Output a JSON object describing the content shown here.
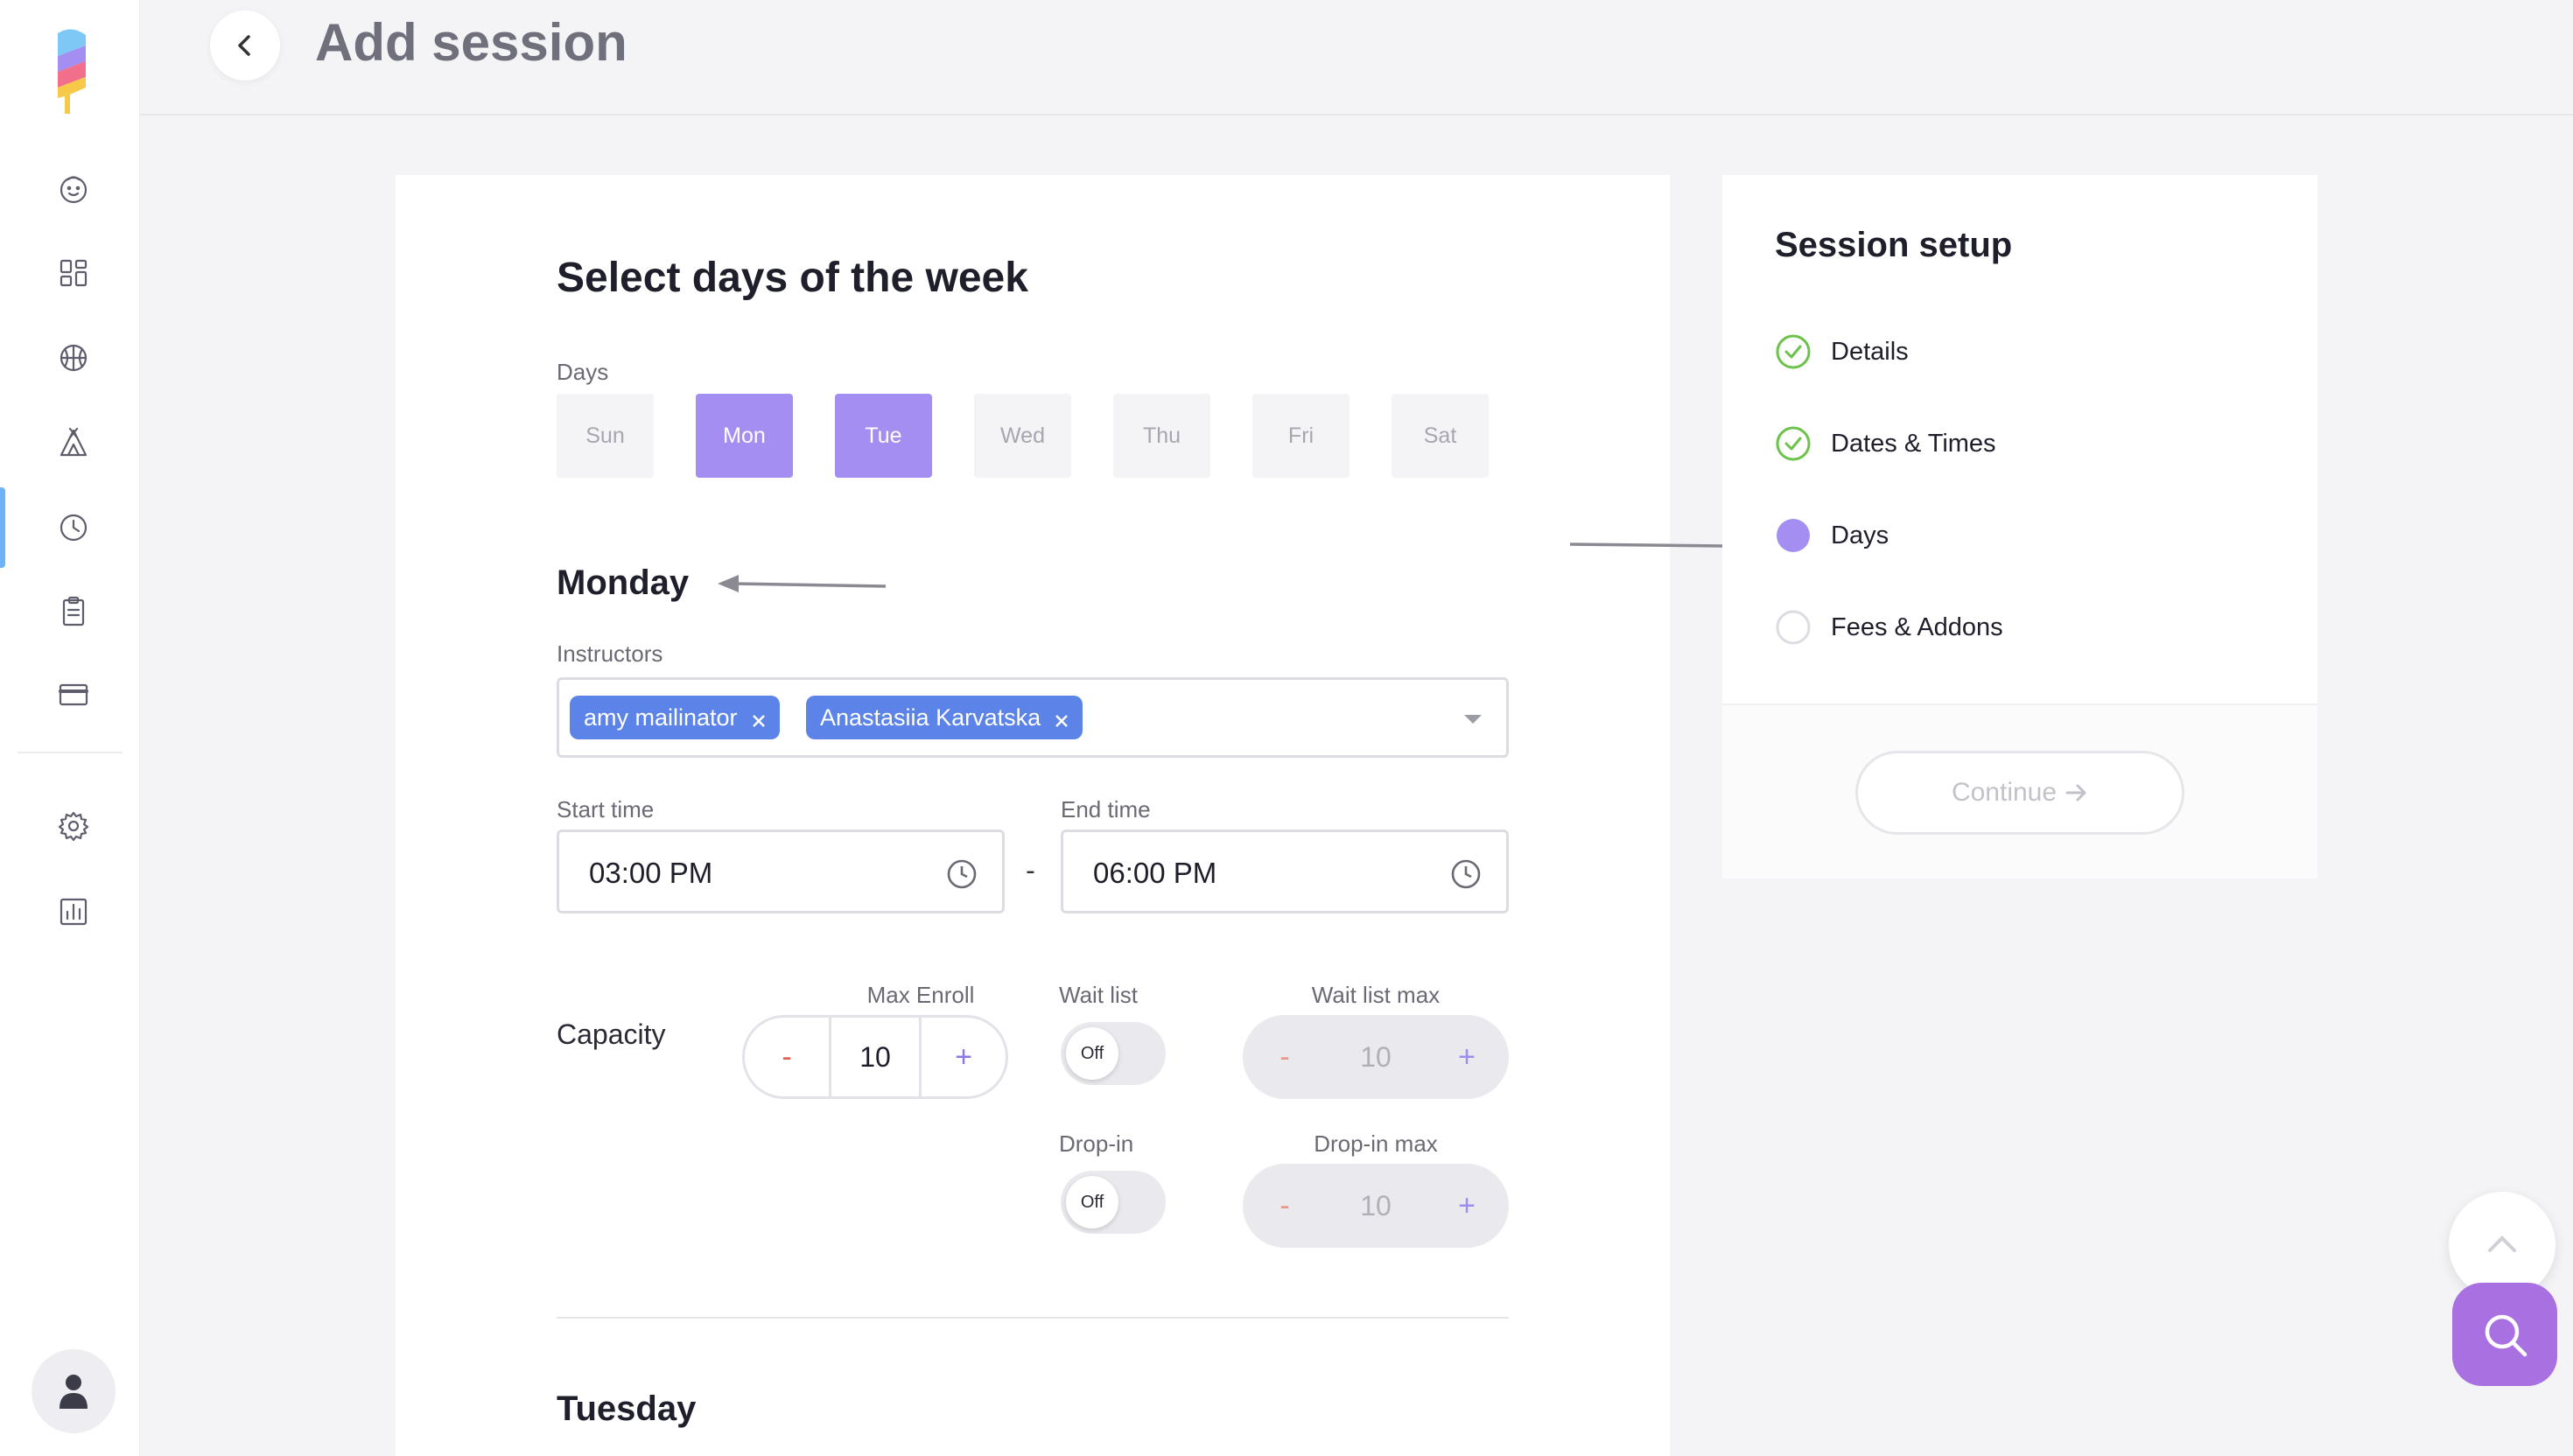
{
  "header": {
    "title": "Add session"
  },
  "main": {
    "section_title": "Select days of the week",
    "days_label": "Days",
    "days": [
      {
        "label": "Sun",
        "selected": false
      },
      {
        "label": "Mon",
        "selected": true
      },
      {
        "label": "Tue",
        "selected": true
      },
      {
        "label": "Wed",
        "selected": false
      },
      {
        "label": "Thu",
        "selected": false
      },
      {
        "label": "Fri",
        "selected": false
      },
      {
        "label": "Sat",
        "selected": false
      }
    ],
    "monday": {
      "heading": "Monday",
      "instructors_label": "Instructors",
      "instructors": [
        "amy mailinator",
        "Anastasiia Karvatska"
      ],
      "start_label": "Start time",
      "start_value": "03:00 PM",
      "end_label": "End time",
      "end_value": "06:00 PM",
      "dash": "-",
      "capacity_label": "Capacity",
      "max_enroll_label": "Max Enroll",
      "max_enroll": "10",
      "wait_list_label": "Wait list",
      "wait_list_state": "Off",
      "wait_list_max_label": "Wait list max",
      "wait_list_max": "10",
      "drop_in_label": "Drop-in",
      "drop_in_state": "Off",
      "drop_in_max_label": "Drop-in max",
      "drop_in_max": "10",
      "minus": "-",
      "plus": "+"
    },
    "tuesday": {
      "heading": "Tuesday"
    }
  },
  "setup": {
    "title": "Session setup",
    "steps": [
      {
        "label": "Details",
        "state": "done"
      },
      {
        "label": "Dates & Times",
        "state": "done"
      },
      {
        "label": "Days",
        "state": "current"
      },
      {
        "label": "Fees & Addons",
        "state": "pending"
      }
    ],
    "continue_label": "Continue"
  },
  "colors": {
    "accent_purple": "#a48ef2",
    "chip_blue": "#5b83e8",
    "check_green": "#6cc24a",
    "nav_active": "#6fb3f7",
    "search_fab": "#a970e2"
  },
  "icons": [
    "logo-icon",
    "child-face-icon",
    "dashboard-icon",
    "basketball-icon",
    "camp-tent-icon",
    "clock-icon",
    "clipboard-icon",
    "credit-card-icon",
    "gear-icon",
    "report-chart-icon",
    "user-icon",
    "chevron-left-icon",
    "close-icon",
    "chevron-down-icon",
    "arrow-right-icon",
    "chevron-up-icon",
    "search-icon"
  ]
}
